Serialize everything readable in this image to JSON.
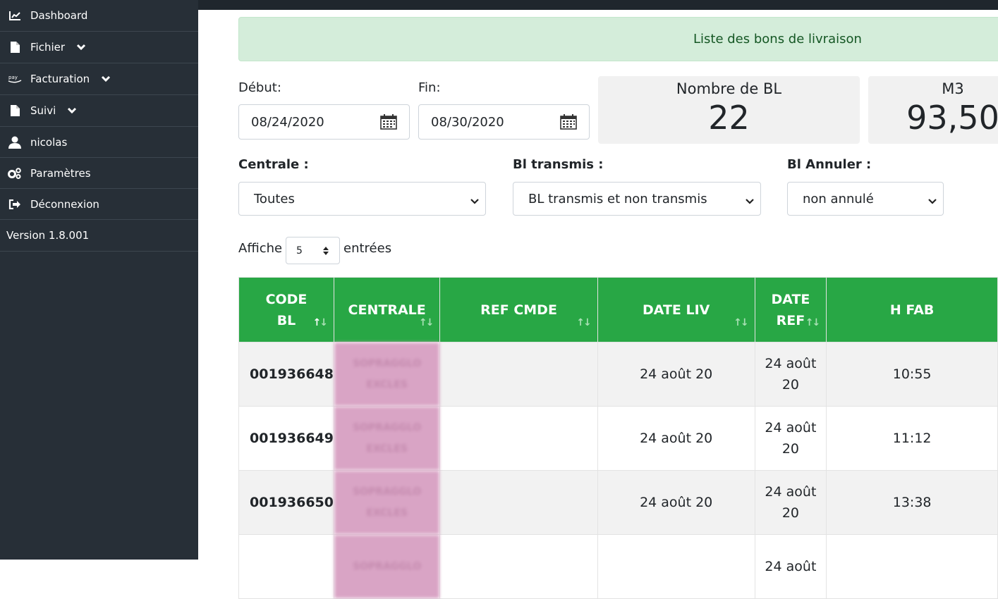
{
  "sidebar": {
    "items": [
      {
        "label": "Dashboard",
        "icon": "chart-line-icon"
      },
      {
        "label": "Fichier",
        "icon": "file-icon",
        "has_submenu": true
      },
      {
        "label": "Facturation",
        "icon": "pay-icon",
        "has_submenu": true
      },
      {
        "label": "Suivi",
        "icon": "file-icon",
        "has_submenu": true
      },
      {
        "label": "nicolas",
        "icon": "user-icon"
      },
      {
        "label": "Paramètres",
        "icon": "cogs-icon"
      },
      {
        "label": "Déconnexion",
        "icon": "sign-out-icon"
      }
    ],
    "version": "Version 1.8.001"
  },
  "alert": {
    "text": "Liste des bons de livraison"
  },
  "dates": {
    "start_label": "Début:",
    "start_value": "08/24/2020",
    "end_label": "Fin:",
    "end_value": "08/30/2020"
  },
  "stats": {
    "count_title": "Nombre de BL",
    "count_value": "22",
    "m3_title": "M3",
    "m3_value": "93,50"
  },
  "filters": {
    "centrale_label": "Centrale :",
    "centrale_value": "Toutes",
    "transmis_label": "Bl transmis :",
    "transmis_value": "BL transmis et non transmis",
    "annuler_label": "Bl Annuler :",
    "annuler_value": "non annulé"
  },
  "length": {
    "prefix": "Affiche",
    "value": "5",
    "suffix": "entrées"
  },
  "table": {
    "headers": {
      "code_line1": "CODE",
      "code_line2": "BL",
      "centrale": "CENTRALE",
      "ref_cmde": "REF CMDE",
      "date_liv": "DATE LIV",
      "date_ref_line1": "DATE",
      "date_ref_line2": "REF",
      "h_fab": "H FAB"
    },
    "rows": [
      {
        "code": "001936648",
        "centrale_line1": "SOPRAGGLO",
        "centrale_line2": "EXCLES",
        "ref_cmde": "",
        "date_liv": "24 août 20",
        "date_ref_line1": "24 août",
        "date_ref_line2": "20",
        "h_fab": "10:55"
      },
      {
        "code": "001936649",
        "centrale_line1": "SOPRAGGLO",
        "centrale_line2": "EXCLES",
        "ref_cmde": "",
        "date_liv": "24 août 20",
        "date_ref_line1": "24 août",
        "date_ref_line2": "20",
        "h_fab": "11:12"
      },
      {
        "code": "001936650",
        "centrale_line1": "SOPRAGGLO",
        "centrale_line2": "EXCLES",
        "ref_cmde": "",
        "date_liv": "24 août 20",
        "date_ref_line1": "24 août",
        "date_ref_line2": "20",
        "h_fab": "13:38"
      },
      {
        "code": "",
        "centrale_line1": "SOPRAGGLO",
        "centrale_line2": "",
        "ref_cmde": "",
        "date_liv": "",
        "date_ref_line1": "24 août",
        "date_ref_line2": "",
        "h_fab": ""
      }
    ]
  }
}
